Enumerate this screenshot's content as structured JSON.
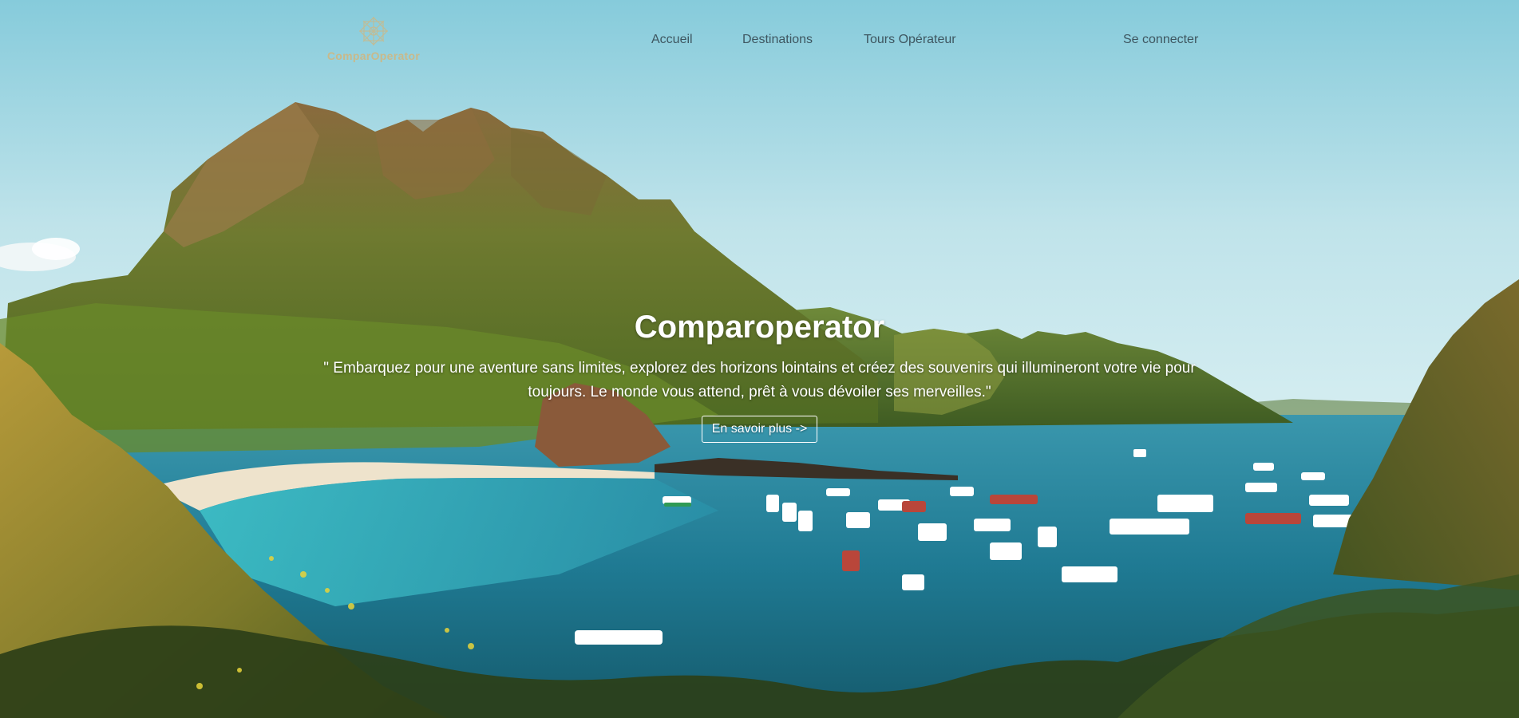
{
  "brand": {
    "name": "ComparOperator",
    "logo_icon": "compass-star-icon",
    "logo_color": "#c9b98a"
  },
  "nav": {
    "items": [
      {
        "label": "Accueil"
      },
      {
        "label": "Destinations"
      },
      {
        "label": "Tours Opérateur"
      }
    ],
    "login_label": "Se connecter",
    "text_color": "#3e5660"
  },
  "hero": {
    "title": "Comparoperator",
    "quote": "\" Embarquez pour une aventure sans limites, explorez des horizons lointains et créez des souvenirs qui illumineront votre vie pour toujours. Le monde vous attend, prêt à vous dévoiler ses merveilles.\"",
    "button_label": "En savoir plus ->",
    "background_image": "tropical-bay-with-mountains-and-boats",
    "text_color": "#ffffff"
  }
}
